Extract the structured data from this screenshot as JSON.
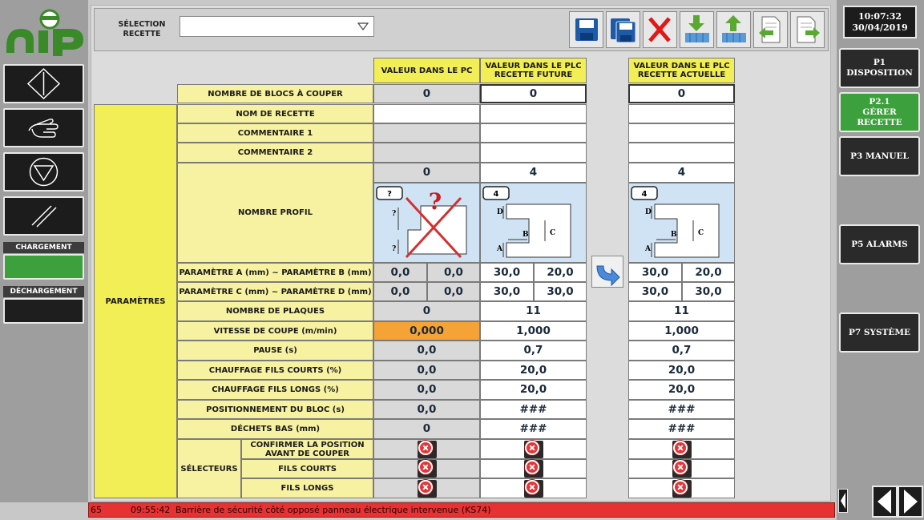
{
  "clock": {
    "time": "10:07:32",
    "date": "30/04/2019"
  },
  "left_panel": {
    "chargement_label": "CHARGEMENT",
    "dechargement_label": "DÉCHARGEMENT",
    "chargement_color": "#3ca03c"
  },
  "right_nav": [
    {
      "label": "P1 DISPOSITION"
    },
    {
      "label": "P2.1 GÉRER RECETTE",
      "active": true
    },
    {
      "label": "P3 MANUEL"
    },
    {
      "label": "P5 ALARMS"
    },
    {
      "label": "P7 SYSTÈME"
    }
  ],
  "toolbar": {
    "selection_label": "SÉLECTION RECETTE",
    "selection_value": "",
    "buttons": [
      "save-icon",
      "save-as-icon",
      "delete-icon",
      "download-icon",
      "upload-icon",
      "import-icon",
      "export-icon"
    ]
  },
  "table": {
    "headers": {
      "pc": "VALEUR DANS LE PC",
      "plc_future": "VALEUR DANS LE PLC RECETTE FUTURE",
      "plc_current": "VALEUR DANS LE PLC RECETTE ACTUELLE"
    },
    "group_label": "PARAMÈTRES",
    "selectors_label": "SÉLECTEURS",
    "rows": {
      "blocs": {
        "label": "NOMBRE DE BLOCS À COUPER",
        "pc": "0",
        "future": "0",
        "current": "0"
      },
      "nom": {
        "label": "NOM DE RECETTE",
        "pc": "",
        "future": "",
        "current": ""
      },
      "comment1": {
        "label": "COMMENTAIRE 1",
        "pc": "",
        "future": "",
        "current": ""
      },
      "comment2": {
        "label": "COMMENTAIRE 2",
        "pc": "",
        "future": "",
        "current": ""
      },
      "profil": {
        "label": "NOMBRE PROFIL",
        "pc": "0",
        "future": "4",
        "current": "4",
        "pc_badge": "?",
        "future_badge": "4",
        "current_badge": "4"
      },
      "param_ab": {
        "label": "PARAMÈTRE A (mm) ~ PARAMÈTRE B (mm)",
        "pc_a": "0,0",
        "pc_b": "0,0",
        "future_a": "30,0",
        "future_b": "20,0",
        "current_a": "30,0",
        "current_b": "20,0"
      },
      "param_cd": {
        "label": "PARAMÈTRE C (mm) ~ PARAMÈTRE D (mm)",
        "pc_a": "0,0",
        "pc_b": "0,0",
        "future_a": "30,0",
        "future_b": "30,0",
        "current_a": "30,0",
        "current_b": "30,0"
      },
      "plaques": {
        "label": "NOMBRE DE PLAQUES",
        "pc": "0",
        "future": "11",
        "current": "11"
      },
      "vitesse": {
        "label": "VITESSE DE COUPE (m/min)",
        "pc": "0,000",
        "future": "1,000",
        "current": "1,000"
      },
      "pause": {
        "label": "PAUSE (s)",
        "pc": "0,0",
        "future": "0,7",
        "current": "0,7"
      },
      "chauffe_courts": {
        "label": "CHAUFFAGE FILS COURTS (%)",
        "pc": "0,0",
        "future": "20,0",
        "current": "20,0"
      },
      "chauffe_longs": {
        "label": "CHAUFFAGE FILS LONGS (%)",
        "pc": "0,0",
        "future": "20,0",
        "current": "20,0"
      },
      "position": {
        "label": "POSITIONNEMENT DU BLOC (s)",
        "pc": "0,0",
        "future": "###",
        "current": "###"
      },
      "dechets": {
        "label": "DÉCHETS BAS (mm)",
        "pc": "0",
        "future": "###",
        "current": "###"
      }
    },
    "selectors": [
      {
        "label": "CONFIRMER LA POSITION AVANT DE COUPER"
      },
      {
        "label": "FILS COURTS"
      },
      {
        "label": "FILS LONGS"
      }
    ],
    "diagram_labels": {
      "a": "A",
      "b": "B",
      "c": "C",
      "d": "D",
      "q": "?"
    }
  },
  "status_bar": {
    "code": "65",
    "time": "09:55:42",
    "message": "Barrière de sécurité côté opposé panneau électrique intervenue (KS74)"
  }
}
